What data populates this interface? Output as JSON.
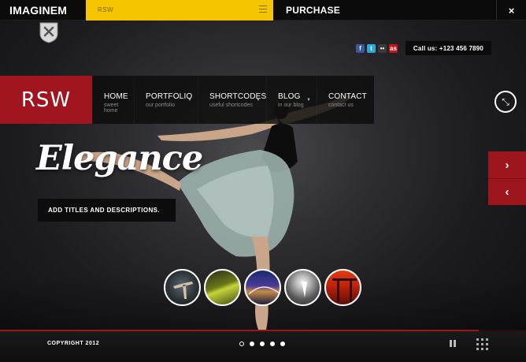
{
  "topbar": {
    "brand": "IMAGINEM",
    "theme_select_value": "RSW",
    "purchase_label": "PURCHASE",
    "close_icon": "×"
  },
  "header": {
    "social_icons": [
      "facebook-icon",
      "twitter-icon",
      "flickr-icon",
      "lastfm-icon"
    ],
    "call_text": "Call us: +123 456 7890"
  },
  "nav": {
    "logo": "RSW",
    "items": [
      {
        "title": "HOME",
        "subtitle": "sweet home"
      },
      {
        "title": "PORTFOLIO",
        "subtitle": "our portfolio"
      },
      {
        "title": "SHORTCODES",
        "subtitle": "useful shortcodes"
      },
      {
        "title": "BLOG",
        "subtitle": "in our blog"
      },
      {
        "title": "CONTACT",
        "subtitle": "contact us"
      }
    ]
  },
  "slide": {
    "headline": "Elegance",
    "subtitle": "ADD TITLES AND DESCRIPTIONS.",
    "next_arrow": "›",
    "prev_arrow": "‹"
  },
  "thumbnails": [
    {
      "name": "thumb-dancer"
    },
    {
      "name": "thumb-grass"
    },
    {
      "name": "thumb-bridge"
    },
    {
      "name": "thumb-lamp"
    },
    {
      "name": "thumb-torii"
    }
  ],
  "footer": {
    "copyright": "COPYRIGHT 2012",
    "slide_count": 5,
    "active_slide": 1,
    "progress": 0.91
  },
  "colors": {
    "accent_red": "#9d151d",
    "topbar_yellow": "#f5c600"
  }
}
